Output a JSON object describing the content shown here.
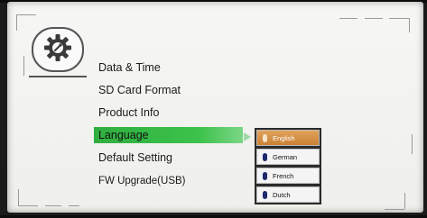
{
  "menu": {
    "items": [
      {
        "label": "Data & Time",
        "selected": false
      },
      {
        "label": "SD Card Format",
        "selected": false
      },
      {
        "label": "Product Info",
        "selected": false
      },
      {
        "label": "Language",
        "selected": true
      },
      {
        "label": "Default Setting",
        "selected": false
      },
      {
        "label": "FW Upgrade(USB)",
        "selected": false
      }
    ]
  },
  "language_submenu": {
    "options": [
      {
        "label": "English",
        "selected": true
      },
      {
        "label": "German",
        "selected": false
      },
      {
        "label": "French",
        "selected": false
      },
      {
        "label": "Dutch",
        "selected": false
      }
    ]
  },
  "icons": {
    "settings": "gear-icon",
    "option_marker": "mic-icon"
  },
  "colors": {
    "selected_item": "#3cc24a",
    "selected_language": "#d48f45",
    "screen_background": "#f3f3f1"
  }
}
